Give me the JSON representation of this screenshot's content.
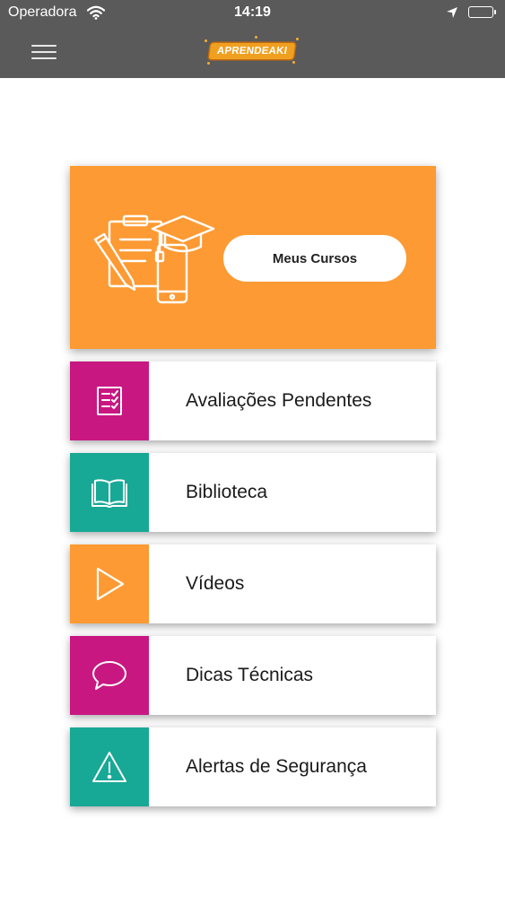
{
  "status_bar": {
    "carrier": "Operadora",
    "time": "14:19",
    "icons": [
      "wifi-icon",
      "location-arrow-icon",
      "battery-icon"
    ]
  },
  "nav_bar": {
    "menu_icon": "hamburger-icon",
    "logo_text": "APRENDEAKI"
  },
  "hero": {
    "button_label": "Meus Cursos",
    "illustration": "clipboard-graduation-cap-phone-illustration",
    "background_color": "#fd9a33"
  },
  "menu_items": [
    {
      "label": "Avaliações Pendentes",
      "icon": "checklist-icon",
      "color": "#c91782"
    },
    {
      "label": "Biblioteca",
      "icon": "open-book-icon",
      "color": "#18a896"
    },
    {
      "label": "Vídeos",
      "icon": "play-icon",
      "color": "#fd9a33"
    },
    {
      "label": "Dicas Técnicas",
      "icon": "speech-bubble-icon",
      "color": "#c91782"
    },
    {
      "label": "Alertas de Segurança",
      "icon": "warning-triangle-icon",
      "color": "#18a896"
    }
  ]
}
